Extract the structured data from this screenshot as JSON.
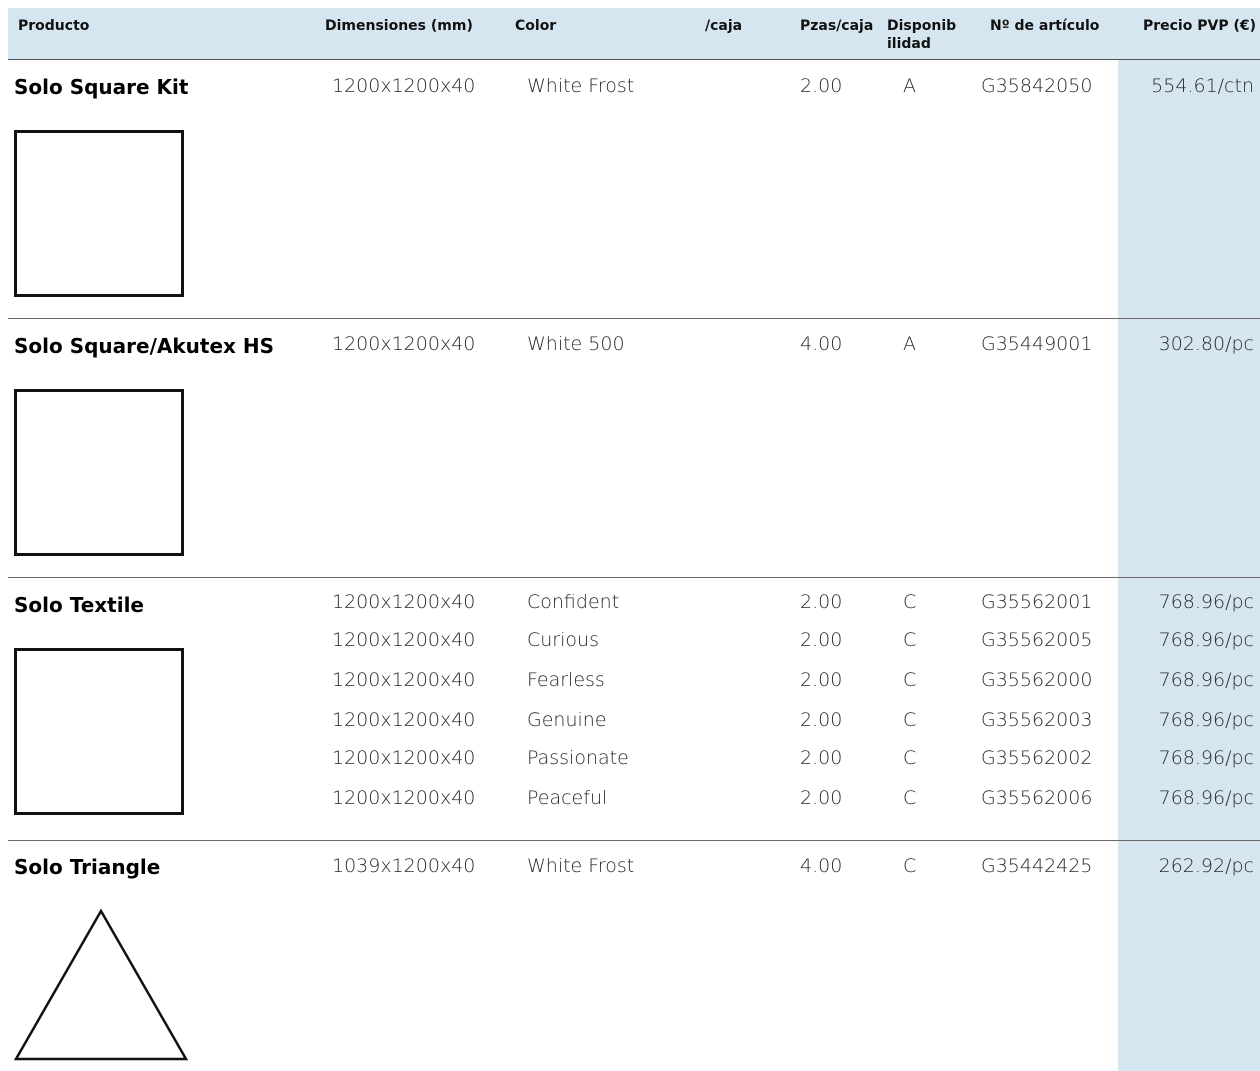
{
  "headers": {
    "producto": "Producto",
    "dimensiones": "Dimensiones (mm)",
    "color": "Color",
    "caja": "/caja",
    "pzas": "Pzas/caja",
    "disponibilidad": "Disponibilidad",
    "articulo": "Nº de artículo",
    "precio": "Precio PVP (€)"
  },
  "products": [
    {
      "name": "Solo Square Kit",
      "thumbnail": "square-outline",
      "rows": [
        {
          "dim": "1200x1200x40",
          "color": "White Frost",
          "pzas": "2.00",
          "avail": "A",
          "article": "G35842050",
          "price": "554.61/ctn"
        }
      ]
    },
    {
      "name": "Solo Square/Akutex HS",
      "thumbnail": "square-outline",
      "rows": [
        {
          "dim": "1200x1200x40",
          "color": "White 500",
          "pzas": "4.00",
          "avail": "A",
          "article": "G35449001",
          "price": "302.80/pc"
        }
      ]
    },
    {
      "name": "Solo Textile",
      "thumbnail": "square-outline",
      "rows": [
        {
          "dim": "1200x1200x40",
          "color": "Confident",
          "pzas": "2.00",
          "avail": "C",
          "article": "G35562001",
          "price": "768.96/pc"
        },
        {
          "dim": "1200x1200x40",
          "color": "Curious",
          "pzas": "2.00",
          "avail": "C",
          "article": "G35562005",
          "price": "768.96/pc"
        },
        {
          "dim": "1200x1200x40",
          "color": "Fearless",
          "pzas": "2.00",
          "avail": "C",
          "article": "G35562000",
          "price": "768.96/pc"
        },
        {
          "dim": "1200x1200x40",
          "color": "Genuine",
          "pzas": "2.00",
          "avail": "C",
          "article": "G35562003",
          "price": "768.96/pc"
        },
        {
          "dim": "1200x1200x40",
          "color": "Passionate",
          "pzas": "2.00",
          "avail": "C",
          "article": "G35562002",
          "price": "768.96/pc"
        },
        {
          "dim": "1200x1200x40",
          "color": "Peaceful",
          "pzas": "2.00",
          "avail": "C",
          "article": "G35562006",
          "price": "768.96/pc"
        }
      ]
    },
    {
      "name": "Solo Triangle",
      "thumbnail": "triangle-outline",
      "rows": [
        {
          "dim": "1039x1200x40",
          "color": "White Frost",
          "pzas": "4.00",
          "avail": "C",
          "article": "G35442425",
          "price": "262.92/pc"
        }
      ]
    }
  ],
  "colors": {
    "header_bg": "#d6e6f1",
    "price_band_bg": "#d6e6f1",
    "separator": "#6a6a6a"
  }
}
